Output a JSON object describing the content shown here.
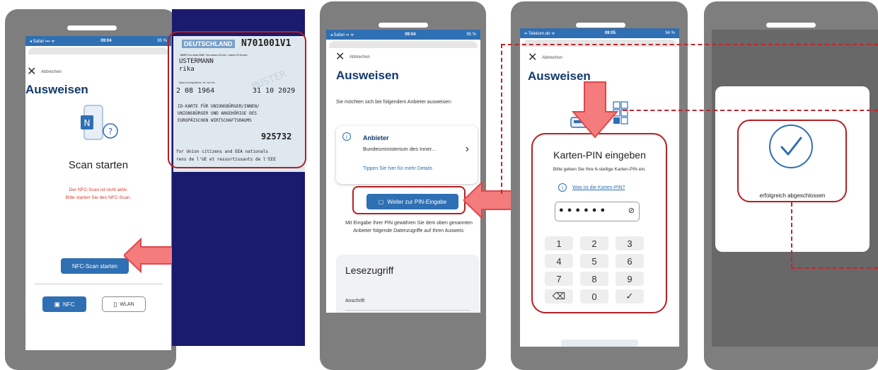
{
  "screen1": {
    "status": {
      "carrier": "◂ Safari ▪▪▪ ᯤ",
      "time": "09:04",
      "battery": "95 %"
    },
    "abbrechen": "Abbrechen",
    "title": "Ausweisen",
    "heading": "Scan starten",
    "error_line1": "Der NFC-Scan ist nicht aktiv.",
    "error_line2": "Bitte starten Sie den NFC-Scan.",
    "scan_button": "NFC-Scan starten",
    "nfc_button": "NFC",
    "wlan_button": "WLAN"
  },
  "idcard": {
    "country": "DEUTSCHLAND",
    "number": "N701001V1",
    "header_small": "NAME/Surname/NOM   Vornamen/Given names/Prénoms",
    "surname": "USTERMANN",
    "given": "rika",
    "dob_label": "Geburtstag/Date of birth",
    "dob": "2 08 1964",
    "expiry": "31 10 2029",
    "line1": "ID-KARTE FÜR UNIONSBÜRGER/INNEN/",
    "line2": "UNIONSBÜRGER UND ANGEHÖRIGE DES",
    "line3": "EUROPÄISCHEN WIRTSCHAFTSRAUMS",
    "can": "925732",
    "foot1": "for Union citizens and EEA nationals",
    "foot2": "rens de l'UE et ressortissants de l'EEE",
    "watermark": "MUSTER"
  },
  "screen2": {
    "status": {
      "carrier": "◂ Safari ▪▪ ᯤ",
      "time": "09:04",
      "battery": "95 %"
    },
    "abbrechen": "Abbrechen",
    "title": "Ausweisen",
    "intro": "Sie möchten sich bei folgendem Anbieter ausweisen:",
    "provider_label": "Anbieter",
    "provider_name": "Bundesministerium des Inner...",
    "details_link": "Tippen Sie hier für mehr Details",
    "pin_button": "Weiter zur PIN-Eingabe",
    "consent": "Mit Eingabe Ihrer PIN gewähren Sie dem oben genannten Anbieter folgende Datenzugriffe auf Ihren Ausweis:",
    "section": "Lesezugriff",
    "field": "Anschrift"
  },
  "screen3": {
    "status": {
      "carrier": "▪▪ Telekom.de ᯤ",
      "time": "09:05",
      "battery": "94 %"
    },
    "abbrechen": "Abbrechen",
    "title": "Ausweisen",
    "pin_heading": "Karten-PIN eingeben",
    "pin_hint": "Bitte geben Sie Ihre 6-stellige Karten-PIN ein.",
    "pin_link": "Was ist die Karten-PIN?",
    "pin_dots": "● ● ● ● ● ●",
    "keys": [
      "1",
      "2",
      "3",
      "4",
      "5",
      "6",
      "7",
      "8",
      "9",
      "⌫",
      "0",
      "✓"
    ]
  },
  "screen4": {
    "success": "erfolgreich abgeschlossen"
  },
  "colors": {
    "accent": "#2f6fb3",
    "error": "#d93a2b",
    "callout": "#b22025",
    "arrow": "#f47c7c"
  }
}
